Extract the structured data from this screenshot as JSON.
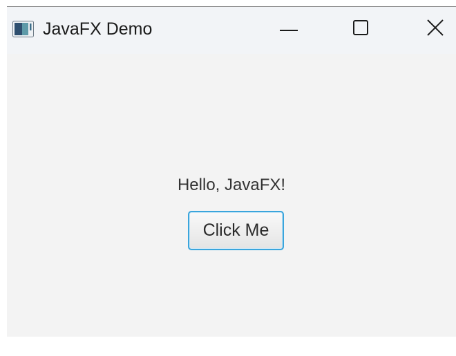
{
  "window": {
    "title": "JavaFX Demo",
    "icon": "javafx-app-icon",
    "controls": {
      "minimize_icon": "minimize-icon",
      "maximize_icon": "maximize-icon",
      "close_icon": "close-icon"
    }
  },
  "content": {
    "label": "Hello, JavaFX!",
    "button_label": "Click Me"
  },
  "colors": {
    "background": "#f3f3f3",
    "titlebar": "#f2f4f7",
    "button_focus_border": "#3aa5dc"
  }
}
